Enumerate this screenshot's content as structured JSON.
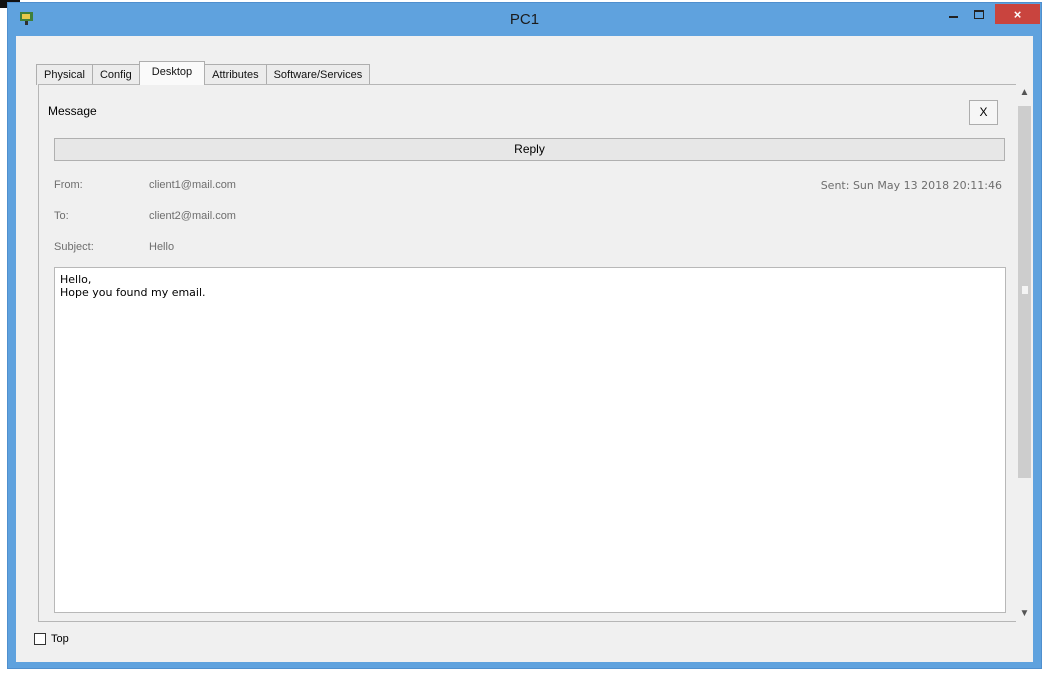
{
  "window": {
    "title": "PC1",
    "close_glyph": "×",
    "icon": "pc-app-icon"
  },
  "tabs": [
    {
      "label": "Physical",
      "active": false
    },
    {
      "label": "Config",
      "active": false
    },
    {
      "label": "Desktop",
      "active": true
    },
    {
      "label": "Attributes",
      "active": false
    },
    {
      "label": "Software/Services",
      "active": false
    }
  ],
  "message": {
    "heading": "Message",
    "close_label": "X",
    "reply_label": "Reply",
    "from_label": "From:",
    "from_value": "client1@mail.com",
    "to_label": "To:",
    "to_value": "client2@mail.com",
    "subject_label": "Subject:",
    "subject_value": "Hello",
    "sent": "Sent: Sun May 13 2018 20:11:46",
    "body": "Hello,\nHope you found my email."
  },
  "footer": {
    "top_label": "Top",
    "top_checked": false
  },
  "colors": {
    "titlebar": "#5fa2de",
    "close_button": "#c9443e",
    "panel_bg": "#f0f0f0"
  }
}
